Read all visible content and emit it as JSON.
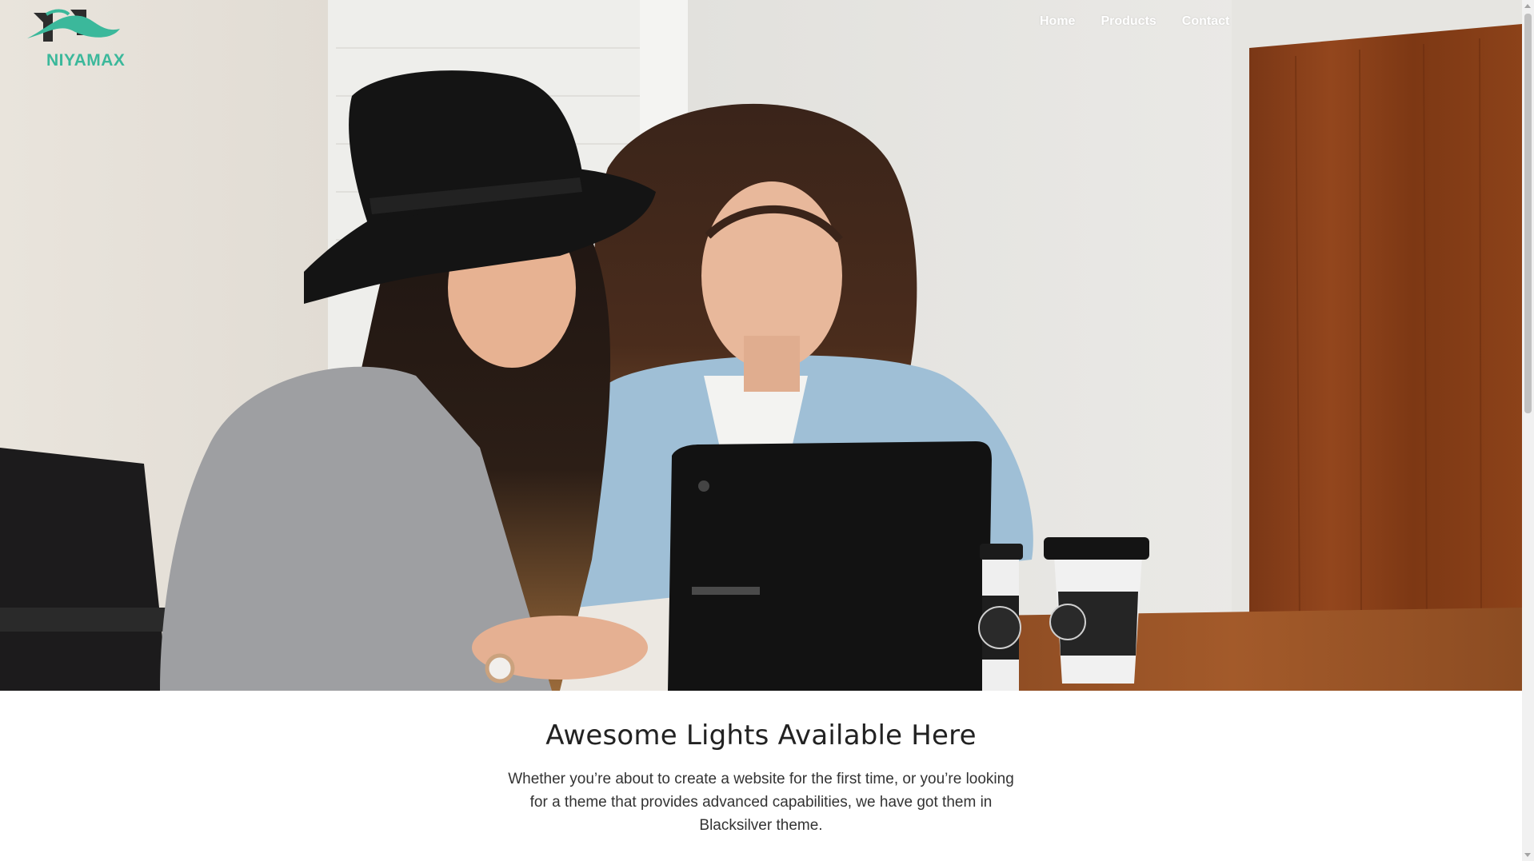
{
  "header": {
    "logo_text": "NIYAMAX",
    "nav": [
      {
        "label": "Home"
      },
      {
        "label": "Products"
      },
      {
        "label": "Contact"
      }
    ]
  },
  "hero": {
    "image_semantic": "hero-photo-two-women-laptop"
  },
  "main": {
    "headline": "Awesome Lights Available Here",
    "body": "Whether you’re about to create a website for the first time, or you’re looking for a theme that provides advanced capabilities, we have got them in Blacksilver theme."
  },
  "colors": {
    "brand": "#3bb89b",
    "nav_text": "#ffffff",
    "headline": "#222222"
  }
}
